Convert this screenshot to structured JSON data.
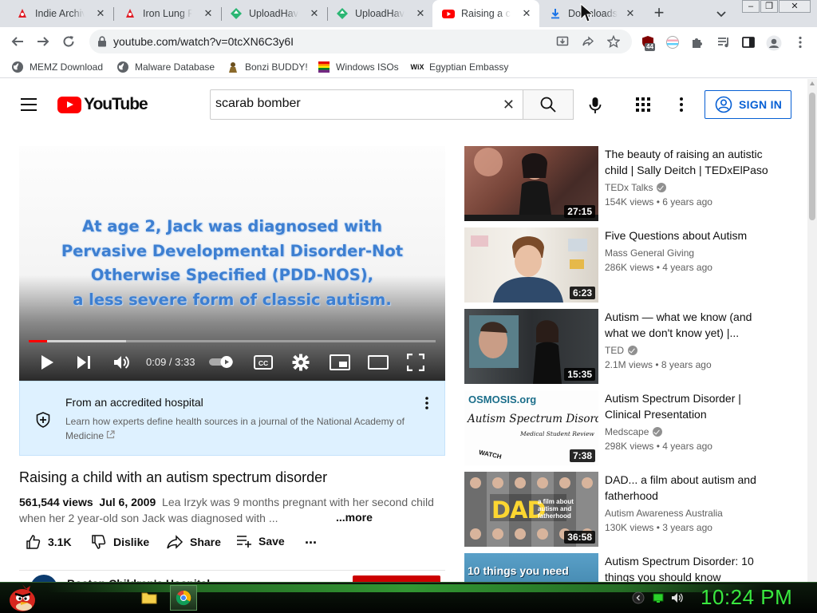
{
  "browser": {
    "tabs": [
      {
        "title": "Indie Archive",
        "icon": "red-logo-icon"
      },
      {
        "title": "Iron Lung Fre",
        "icon": "red-logo-icon"
      },
      {
        "title": "UploadHaven",
        "icon": "uploadhaven-icon"
      },
      {
        "title": "UploadHaven",
        "icon": "uploadhaven-icon"
      },
      {
        "title": "Raising a chi",
        "icon": "youtube-icon"
      },
      {
        "title": "Downloads",
        "icon": "download-icon"
      }
    ],
    "active_tab_index": 4,
    "url": "youtube.com/watch?v=0tcXN6C3y6I",
    "extension_badge": "44",
    "bookmarks": [
      {
        "label": "MEMZ Download",
        "icon": "globe-icon"
      },
      {
        "label": "Malware Database",
        "icon": "globe-icon"
      },
      {
        "label": "Bonzi BUDDY!",
        "icon": "bonzi-icon"
      },
      {
        "label": "Windows ISOs",
        "icon": "windows-icon"
      },
      {
        "label": "Egyptian Embassy",
        "icon": "wix-icon"
      }
    ],
    "bookmark_wix_mark": "WiX"
  },
  "youtube": {
    "logo_text": "YouTube",
    "search_value": "scarab bomber",
    "sign_in_label": "SIGN IN",
    "player": {
      "caption_lines": [
        "At age 2, Jack was diagnosed with",
        "Pervasive Developmental Disorder-Not",
        "Otherwise Specified (PDD-NOS),",
        "a less severe form of classic autism."
      ],
      "time_display": "0:09 / 3:33",
      "progress_fraction": 0.045
    },
    "info_panel": {
      "title": "From an accredited hospital",
      "body": "Learn how experts define health sources in a journal of the National Academy of Medicine"
    },
    "video": {
      "title": "Raising a child with an autism spectrum disorder",
      "views": "561,544 views",
      "date": "Jul 6, 2009",
      "description": "Lea Irzyk was 9 months pregnant with her second child when her 2 year-old son Jack was diagnosed with ...",
      "more_label": "...more"
    },
    "actions": {
      "like_count": "3.1K",
      "dislike_label": "Dislike",
      "share_label": "Share",
      "save_label": "Save",
      "more_label": "..."
    },
    "channel": {
      "name": "Boston Children's Hospital"
    },
    "related": [
      {
        "title": "The beauty of raising an autistic child | Sally Deitch | TEDxElPaso",
        "channel": "TEDx Talks",
        "verified": true,
        "views": "154K views",
        "age": "6 years ago",
        "duration": "27:15"
      },
      {
        "title": "Five Questions about Autism",
        "channel": "Mass General Giving",
        "verified": false,
        "views": "286K views",
        "age": "4 years ago",
        "duration": "6:23"
      },
      {
        "title": "Autism — what we know (and what we don't know yet) |...",
        "channel": "TED",
        "verified": true,
        "views": "2.1M views",
        "age": "8 years ago",
        "duration": "15:35"
      },
      {
        "title": "Autism Spectrum Disorder | Clinical Presentation",
        "channel": "Medscape",
        "verified": true,
        "views": "298K views",
        "age": "4 years ago",
        "duration": "7:38"
      },
      {
        "title": "DAD... a film about autism and fatherhood",
        "channel": "Autism Awareness Australia",
        "verified": false,
        "views": "130K views",
        "age": "3 years ago",
        "duration": "36:58"
      },
      {
        "title": "Autism Spectrum Disorder: 10 things you should know",
        "channel": "",
        "verified": false,
        "views": "",
        "age": "",
        "duration": ""
      }
    ],
    "thumb_text": {
      "osmosis_logo": "OSMOSIS.org",
      "osmosis_title": "Autism Spectrum Disorder",
      "osmosis_sub": "Medical Student Review",
      "osmosis_watch": "WATCH",
      "dad_big": "DAD",
      "dad_small_1": "a film about",
      "dad_small_2": "autism and",
      "dad_small_3": "fatherhood",
      "ten_things": "10 things you need"
    }
  },
  "taskbar": {
    "clock": "10:24 PM"
  },
  "colors": {
    "youtube_red": "#ff0000",
    "link_blue": "#065fd4",
    "info_bg": "#def1ff",
    "clock_green": "#39e83f"
  }
}
